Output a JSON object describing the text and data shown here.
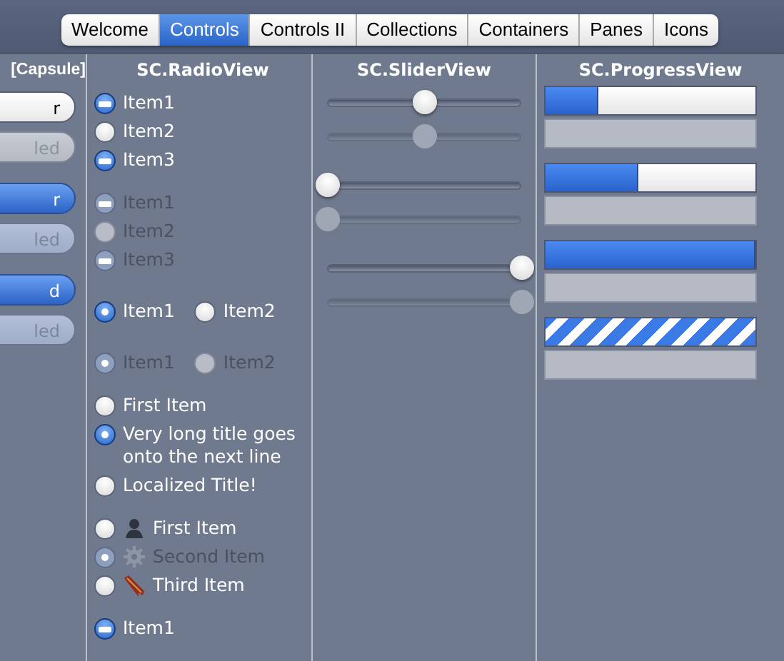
{
  "tabs": [
    {
      "label": "Welcome",
      "selected": false
    },
    {
      "label": "Controls",
      "selected": true
    },
    {
      "label": "Controls II",
      "selected": false
    },
    {
      "label": "Collections",
      "selected": false
    },
    {
      "label": "Containers",
      "selected": false
    },
    {
      "label": "Panes",
      "selected": false
    },
    {
      "label": "Icons",
      "selected": false
    }
  ],
  "button_column": {
    "title": "[Capsule]",
    "buttons": [
      {
        "label": "r",
        "selected": false,
        "disabled": false
      },
      {
        "label": "led",
        "selected": false,
        "disabled": true
      },
      {
        "label": "r",
        "selected": true,
        "disabled": false
      },
      {
        "label": "led",
        "selected": true,
        "disabled": true
      },
      {
        "label": "d",
        "selected": true,
        "disabled": false
      },
      {
        "label": "led",
        "selected": true,
        "disabled": true
      }
    ]
  },
  "radio_column": {
    "title": "SC.RadioView",
    "groups": [
      {
        "kind": "list",
        "mixed": true,
        "items": [
          {
            "label": "Item1",
            "selected": true,
            "disabled": false
          },
          {
            "label": "Item2",
            "selected": false,
            "disabled": false
          },
          {
            "label": "Item3",
            "selected": true,
            "disabled": false
          }
        ]
      },
      {
        "kind": "list",
        "mixed": true,
        "items": [
          {
            "label": "Item1",
            "selected": true,
            "disabled": true
          },
          {
            "label": "Item2",
            "selected": false,
            "disabled": true
          },
          {
            "label": "Item3",
            "selected": true,
            "disabled": true
          }
        ]
      },
      {
        "kind": "row",
        "items": [
          {
            "label": "Item1",
            "selected": true,
            "disabled": false
          },
          {
            "label": "Item2",
            "selected": false,
            "disabled": false
          }
        ]
      },
      {
        "kind": "row",
        "items": [
          {
            "label": "Item1",
            "selected": true,
            "disabled": true
          },
          {
            "label": "Item2",
            "selected": false,
            "disabled": true
          }
        ]
      },
      {
        "kind": "list",
        "items": [
          {
            "label": "First Item",
            "selected": false,
            "disabled": false
          },
          {
            "label": "Very long title goes onto the next line",
            "selected": true,
            "disabled": false
          },
          {
            "label": "Localized Title!",
            "selected": false,
            "disabled": false
          }
        ]
      },
      {
        "kind": "icons",
        "items": [
          {
            "label": "First Item",
            "selected": false,
            "disabled": false
          },
          {
            "label": "Second Item",
            "selected": true,
            "disabled": true
          },
          {
            "label": "Third Item",
            "selected": false,
            "disabled": false
          }
        ]
      },
      {
        "kind": "list",
        "mixed": true,
        "items": [
          {
            "label": "Item1",
            "selected": true,
            "disabled": false
          }
        ]
      }
    ]
  },
  "slider_column": {
    "title": "SC.SliderView",
    "sliders": [
      {
        "level": 0.5,
        "disabled": false
      },
      {
        "level": 0.5,
        "disabled": true
      },
      {
        "level": 0,
        "disabled": false
      },
      {
        "level": 0,
        "disabled": true
      },
      {
        "level": 1,
        "disabled": false
      },
      {
        "level": 1,
        "disabled": true
      }
    ]
  },
  "progress_column": {
    "title": "SC.ProgressView",
    "bars": [
      {
        "kind": "determinate",
        "level": 0.25,
        "disabled": false
      },
      {
        "kind": "empty",
        "disabled": true
      },
      {
        "kind": "determinate",
        "level": 0.44,
        "disabled": false
      },
      {
        "kind": "empty",
        "disabled": true
      },
      {
        "kind": "determinate",
        "level": 1,
        "disabled": false
      },
      {
        "kind": "empty",
        "disabled": true
      },
      {
        "kind": "indeterminate",
        "disabled": false
      },
      {
        "kind": "empty",
        "disabled": true
      }
    ]
  }
}
